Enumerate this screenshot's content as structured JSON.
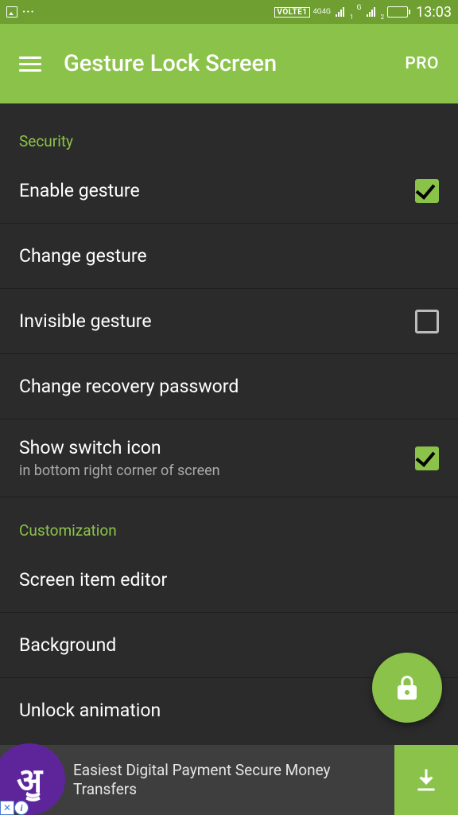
{
  "status": {
    "volte_label": "VOLTE1",
    "net_label": "4G",
    "time": "13:03"
  },
  "appbar": {
    "title": "Gesture Lock Screen",
    "pro_label": "PRO"
  },
  "sections": {
    "security_header": "Security",
    "customization_header": "Customization"
  },
  "items": {
    "enable_gesture": "Enable gesture",
    "change_gesture": "Change gesture",
    "invisible_gesture": "Invisible gesture",
    "change_recovery": "Change recovery password",
    "show_switch_title": "Show switch icon",
    "show_switch_sub": "in bottom right corner of screen",
    "screen_item_editor": "Screen item editor",
    "background": "Background",
    "unlock_animation": "Unlock animation"
  },
  "checkboxes": {
    "enable_gesture": true,
    "invisible_gesture": false,
    "show_switch_icon": true
  },
  "ad": {
    "logo_text": "ॷ",
    "text": "Easiest Digital Payment Secure Money Transfers"
  }
}
